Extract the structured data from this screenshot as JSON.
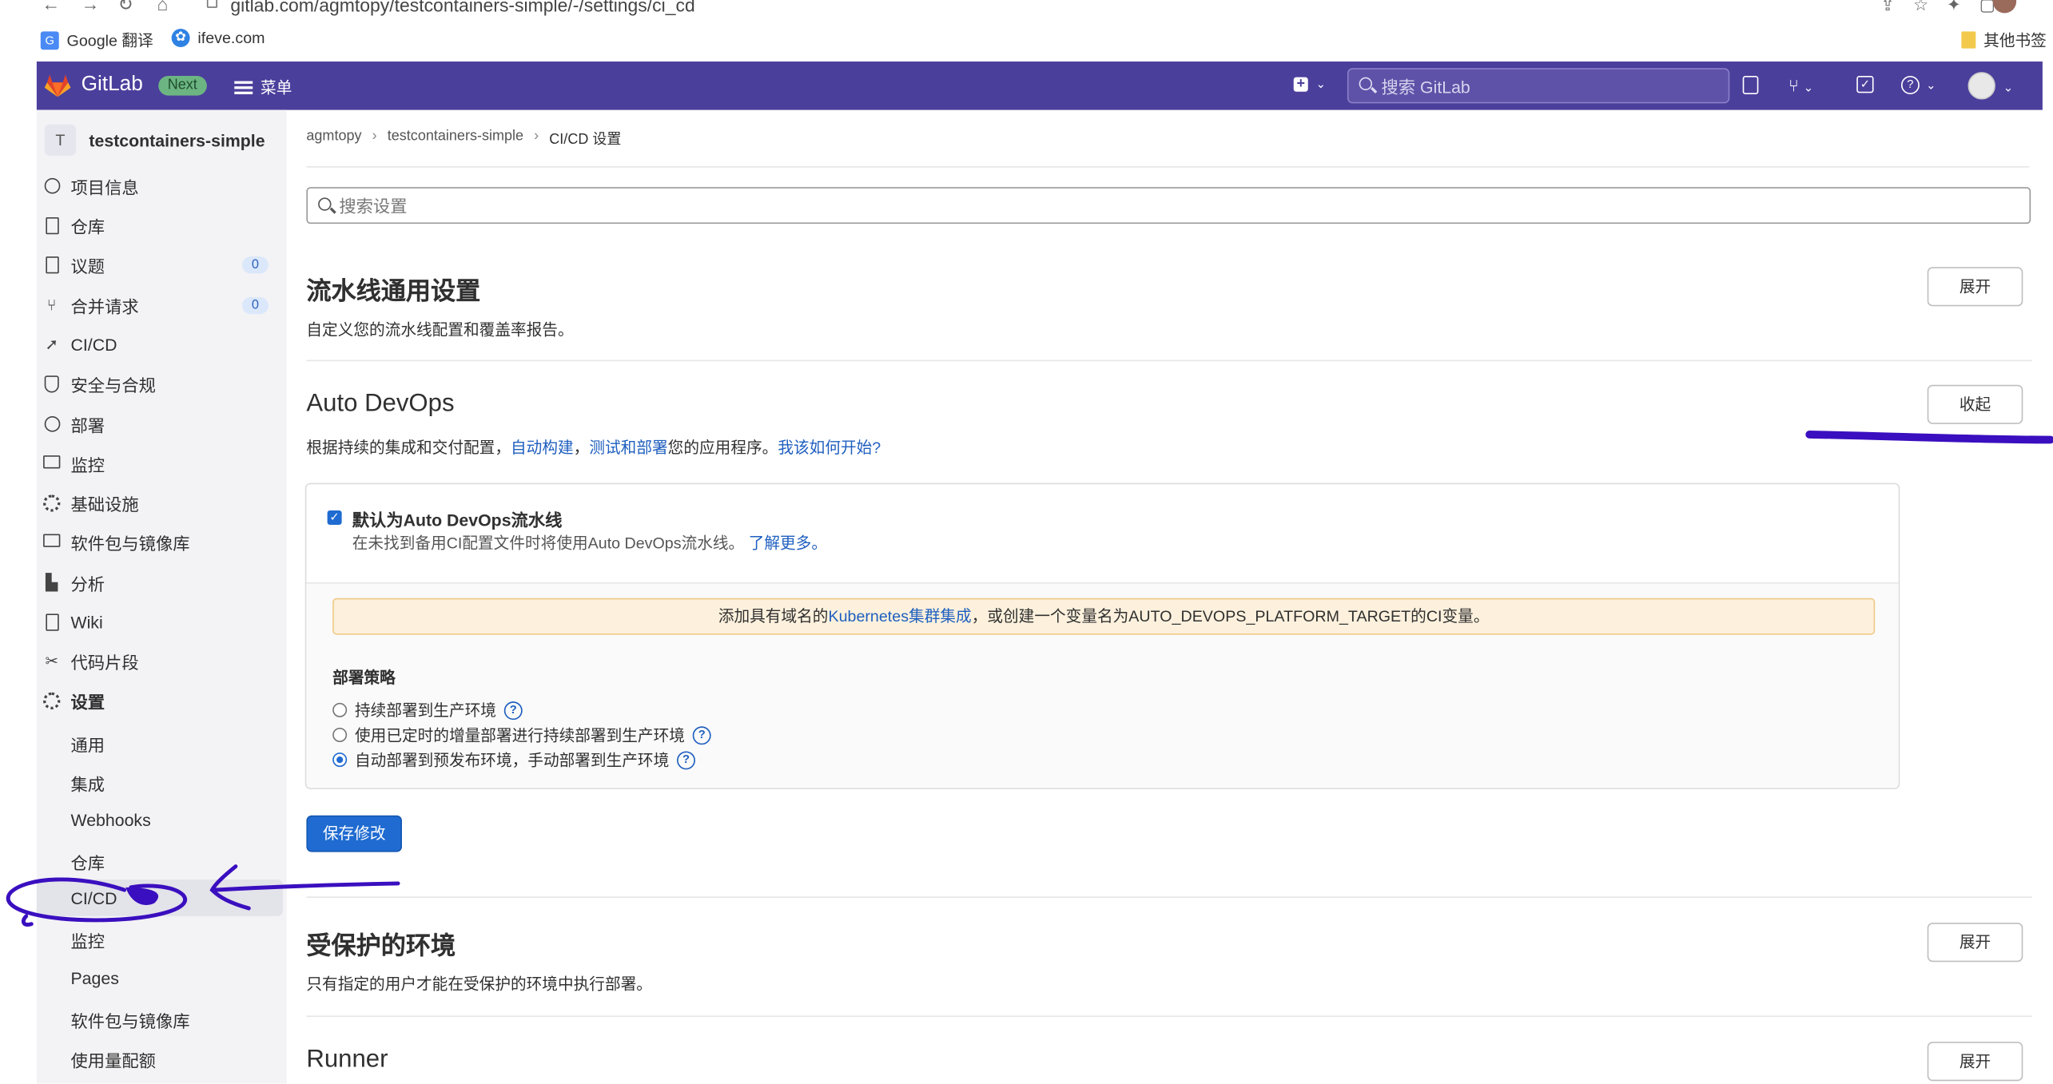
{
  "browser": {
    "url": "gitlab.com/agmtopy/testcontainers-simple/-/settings/ci_cd",
    "bookmarks": [
      {
        "label": "Google 翻译",
        "icon": "google-translate-icon"
      },
      {
        "label": "ifeve.com",
        "icon": "gear-icon"
      }
    ],
    "other_bookmarks": "其他书签"
  },
  "header": {
    "brand": "GitLab",
    "next_badge": "Next",
    "menu_label": "菜单",
    "search_placeholder": "搜索 GitLab",
    "colors": {
      "bar": "#4b3f9c",
      "next": "#6cb582"
    }
  },
  "sidebar": {
    "project_initial": "T",
    "project_name": "testcontainers-simple",
    "items": [
      {
        "label": "项目信息",
        "icon": "info-icon"
      },
      {
        "label": "仓库",
        "icon": "repository-icon"
      },
      {
        "label": "议题",
        "icon": "issues-icon",
        "badge": "0"
      },
      {
        "label": "合并请求",
        "icon": "merge-request-icon",
        "badge": "0"
      },
      {
        "label": "CI/CD",
        "icon": "rocket-icon"
      },
      {
        "label": "安全与合规",
        "icon": "shield-icon"
      },
      {
        "label": "部署",
        "icon": "deployments-icon"
      },
      {
        "label": "监控",
        "icon": "monitor-icon"
      },
      {
        "label": "基础设施",
        "icon": "cloud-gear-icon"
      },
      {
        "label": "软件包与镜像库",
        "icon": "package-icon"
      },
      {
        "label": "分析",
        "icon": "chart-icon"
      },
      {
        "label": "Wiki",
        "icon": "book-icon"
      },
      {
        "label": "代码片段",
        "icon": "snippet-icon"
      },
      {
        "label": "设置",
        "icon": "settings-icon"
      }
    ],
    "sub_items": [
      "通用",
      "集成",
      "Webhooks",
      "仓库",
      "CI/CD",
      "监控",
      "Pages",
      "软件包与镜像库",
      "使用量配额"
    ],
    "active_sub": "CI/CD"
  },
  "breadcrumb": [
    "agmtopy",
    "testcontainers-simple",
    "CI/CD 设置"
  ],
  "settings_search_placeholder": "搜索设置",
  "sections": {
    "pipeline": {
      "title": "流水线通用设置",
      "desc": "自定义您的流水线配置和覆盖率报告。",
      "button": "展开"
    },
    "autodevops": {
      "title": "Auto DevOps",
      "desc_prefix": "根据持续的集成和交付配置，",
      "link1": "自动构建",
      "sep": "，",
      "link2": "测试和部署",
      "desc_mid": "您的应用程序。",
      "link3": "我该如何开始?",
      "button": "收起",
      "checkbox_label": "默认为Auto DevOps流水线",
      "checkbox_checked": true,
      "checkbox_help": "在未找到备用CI配置文件时将使用Auto DevOps流水线。",
      "checkbox_help_link": "了解更多。",
      "warning_prefix": "添加具有域名的",
      "warning_link": "Kubernetes集群集成",
      "warning_suffix": "，或创建一个变量名为AUTO_DEVOPS_PLATFORM_TARGET的CI变量。",
      "strategy_title": "部署策略",
      "strategies": [
        {
          "label": "持续部署到生产环境",
          "selected": false
        },
        {
          "label": "使用已定时的增量部署进行持续部署到生产环境",
          "selected": false
        },
        {
          "label": "自动部署到预发布环境，手动部署到生产环境",
          "selected": true
        }
      ],
      "save_button": "保存修改"
    },
    "protected": {
      "title": "受保护的环境",
      "desc": "只有指定的用户才能在受保护的环境中执行部署。",
      "button": "展开"
    },
    "runner": {
      "title": "Runner",
      "button": "展开"
    }
  }
}
